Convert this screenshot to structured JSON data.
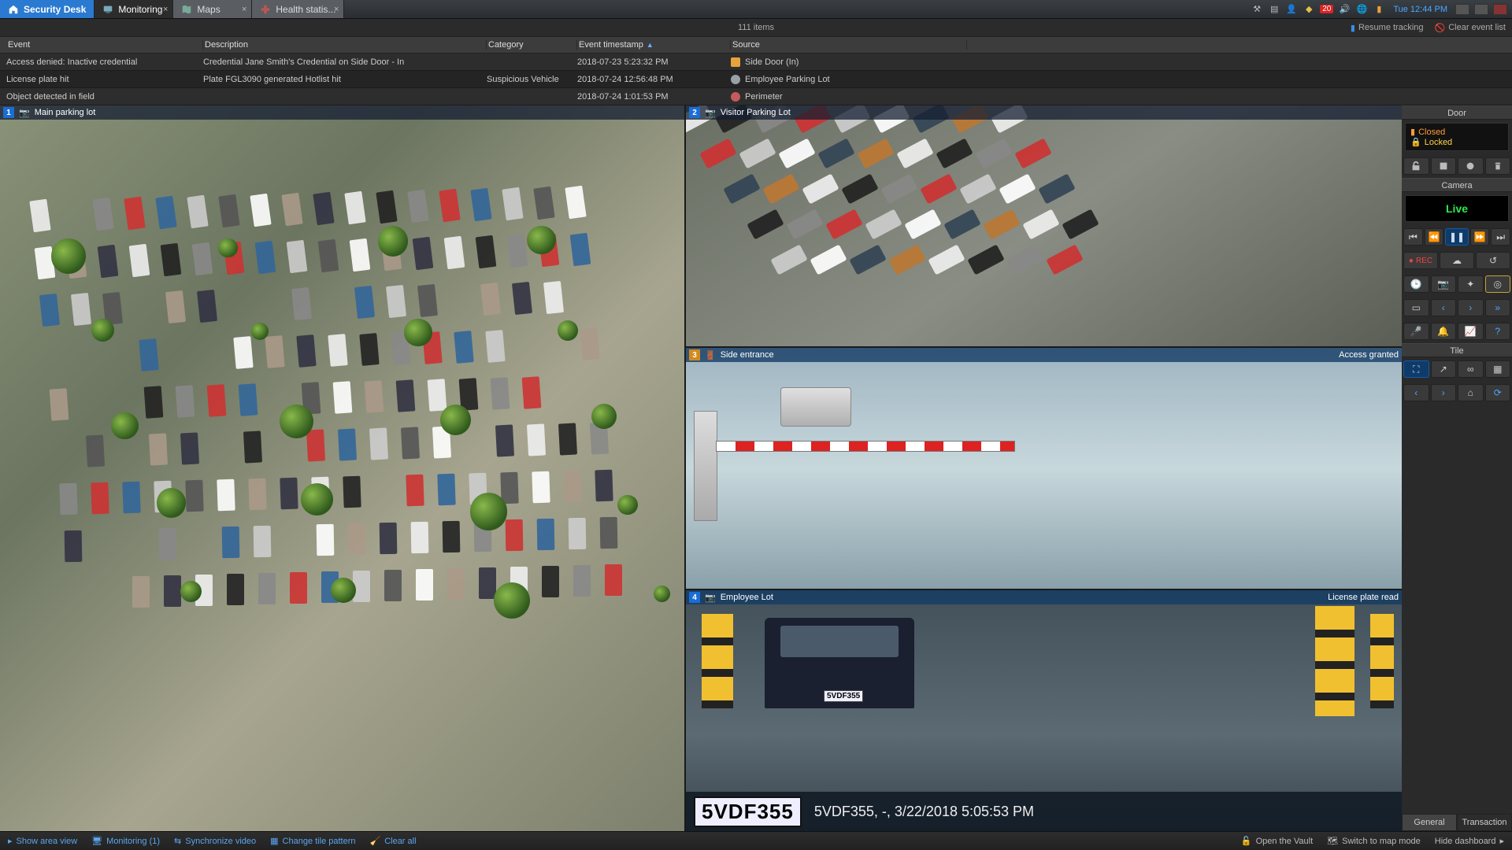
{
  "tabs": {
    "home": "Security Desk",
    "monitoring": "Monitoring",
    "maps": "Maps",
    "health": "Health statis..."
  },
  "tray": {
    "badge": "20",
    "clock": "Tue 12:44 PM"
  },
  "events": {
    "count_label": "111 items",
    "resume_tracking": "Resume tracking",
    "clear_event_list": "Clear event list",
    "columns": {
      "event": "Event",
      "description": "Description",
      "category": "Category",
      "timestamp": "Event timestamp",
      "source": "Source"
    },
    "rows": [
      {
        "event": "Access denied: Inactive credential",
        "description": "Credential Jane Smith's Credential on Side Door - In",
        "category": "",
        "timestamp": "2018-07-23 5:23:32 PM",
        "source": "Side Door (In)",
        "icon_color": "#e6a23c"
      },
      {
        "event": "License plate hit",
        "description": "Plate FGL3090 generated Hotlist hit",
        "category": "Suspicious Vehicle",
        "timestamp": "2018-07-24 12:56:48 PM",
        "source": "Employee Parking Lot",
        "icon_color": "#9aa0a8"
      },
      {
        "event": "Object detected in field",
        "description": "",
        "category": "",
        "timestamp": "2018-07-24 1:01:53 PM",
        "source": "Perimeter",
        "icon_color": "#c65a5a"
      }
    ]
  },
  "tiles": {
    "main": {
      "num": "1",
      "label": "Main parking lot"
    },
    "visitor": {
      "num": "2",
      "label": "Visitor Parking Lot"
    },
    "side": {
      "num": "3",
      "label": "Side entrance",
      "status": "Access granted"
    },
    "employee": {
      "num": "4",
      "label": "Employee Lot",
      "status": "License plate read"
    }
  },
  "plate": {
    "plate_text": "5VDF355",
    "info": "5VDF355, -, 3/22/2018 5:05:53 PM"
  },
  "side_panel": {
    "door_title": "Door",
    "closed": "Closed",
    "locked": "Locked",
    "camera_title": "Camera",
    "live": "Live",
    "rec": "REC",
    "tile_title": "Tile",
    "tabs": {
      "general": "General",
      "transaction": "Transaction"
    }
  },
  "footer": {
    "show_area_view": "Show area view",
    "monitoring": "Monitoring (1)",
    "sync_video": "Synchronize video",
    "change_tile": "Change tile pattern",
    "clear_all": "Clear all",
    "open_vault": "Open the Vault",
    "switch_map": "Switch to map mode",
    "hide_dashboard": "Hide dashboard"
  }
}
